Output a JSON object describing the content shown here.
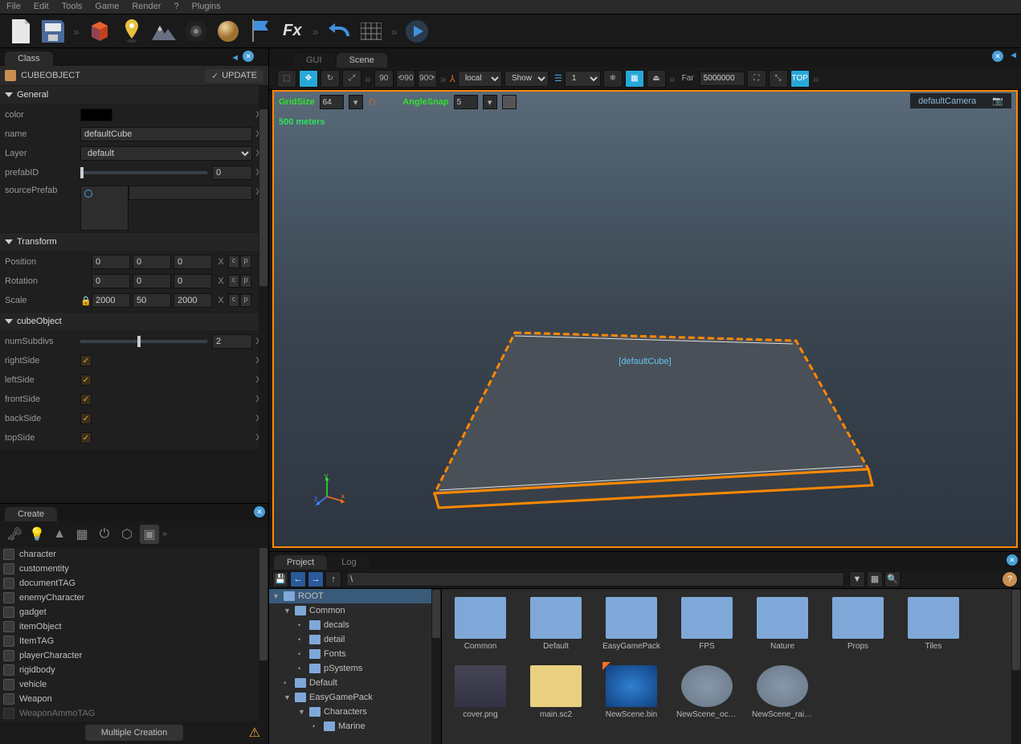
{
  "menu": {
    "file": "File",
    "edit": "Edit",
    "tools": "Tools",
    "game": "Game",
    "render": "Render",
    "help": "?",
    "plugins": "Plugins"
  },
  "classTab": "Class",
  "object": {
    "name": "CUBEOBJECT",
    "update": "UPDATE"
  },
  "sections": {
    "general": "General",
    "transform": "Transform",
    "cubeObject": "cubeObject"
  },
  "props": {
    "color": "color",
    "name": "name",
    "nameVal": "defaultCube",
    "layer": "Layer",
    "layerVal": "default",
    "prefabID": "prefabID",
    "prefabIDVal": "0",
    "sourcePrefab": "sourcePrefab",
    "position": "Position",
    "posX": "0",
    "posY": "0",
    "posZ": "0",
    "rotation": "Rotation",
    "rotX": "0",
    "rotY": "0",
    "rotZ": "0",
    "scale": "Scale",
    "sclX": "2000",
    "sclY": "50",
    "sclZ": "2000",
    "numSubdivs": "numSubdivs",
    "numSubdivsVal": "2",
    "rightSide": "rightSide",
    "leftSide": "leftSide",
    "frontSide": "frontSide",
    "backSide": "backSide",
    "topSide": "topSide"
  },
  "createTab": "Create",
  "createItems": [
    "character",
    "customentity",
    "documentTAG",
    "enemyCharacter",
    "gadget",
    "itemObject",
    "ItemTAG",
    "playerCharacter",
    "rigidbody",
    "vehicle",
    "Weapon",
    "WeaponAmmoTAG"
  ],
  "multipleCreation": "Multiple Creation",
  "scene": {
    "guiTab": "GUI",
    "sceneTab": "Scene"
  },
  "sceneToolbar": {
    "local": "local",
    "show": "Show",
    "one": "1",
    "far": "Far",
    "farVal": "5000000",
    "top": "TOP"
  },
  "viewport": {
    "gridSize": "GridSize",
    "gridVal": "64",
    "angleSnap": "AngleSnap",
    "angleVal": "5",
    "scale": "500 meters",
    "camera": "defaultCamera",
    "cubeLabel": "[defaultCube]"
  },
  "project": {
    "tab": "Project",
    "logTab": "Log",
    "path": "\\",
    "tree": {
      "root": "ROOT",
      "common": "Common",
      "decals": "decals",
      "detail": "detail",
      "fonts": "Fonts",
      "psystems": "pSystems",
      "default": "Default",
      "easygame": "EasyGamePack",
      "characters": "Characters",
      "marine": "Marine"
    },
    "folders": [
      "Common",
      "Default",
      "EasyGamePack",
      "FPS",
      "Nature",
      "Props",
      "Tiles"
    ],
    "files": [
      "cover.png",
      "main.sc2",
      "NewScene.bin",
      "NewScene_oce...",
      "NewScene_rain..."
    ]
  }
}
